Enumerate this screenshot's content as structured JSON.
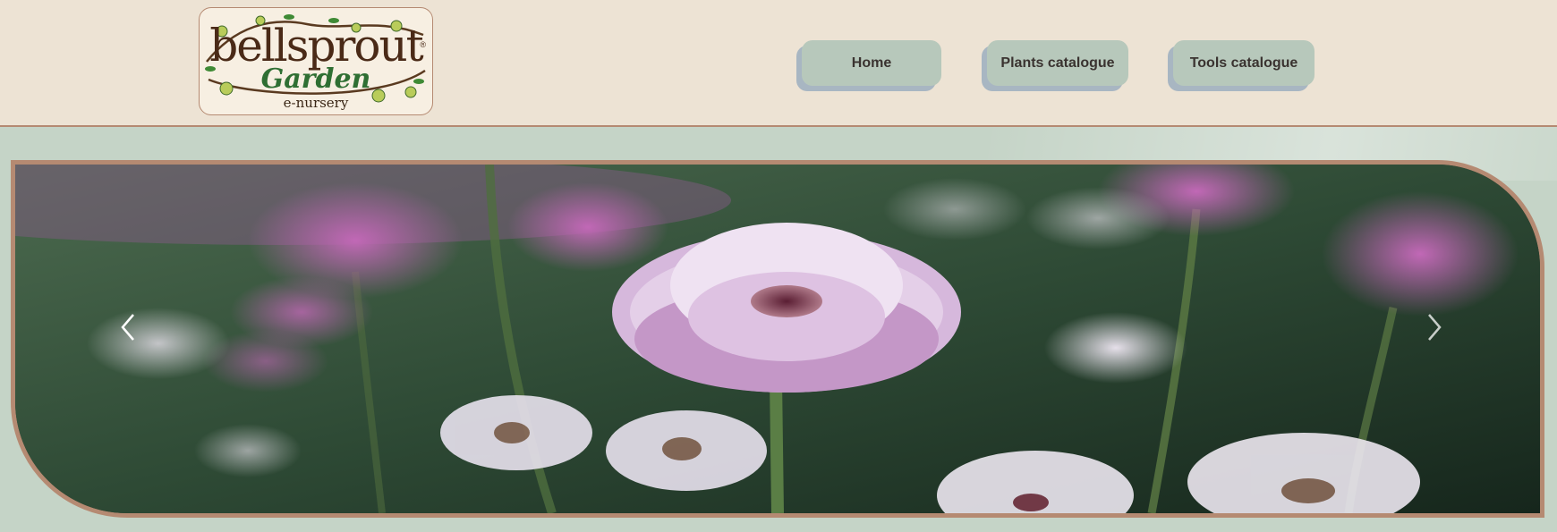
{
  "header": {
    "logo": {
      "brand_word": "bellsprout",
      "garden_word": "Garden",
      "sub_word": "e-nursery",
      "registered": "®"
    },
    "nav": [
      {
        "label": "Home"
      },
      {
        "label": "Plants catalogue"
      },
      {
        "label": "Tools catalogue"
      }
    ]
  },
  "carousel": {
    "image_alt": "flower-garden-photo",
    "prev_icon": "chevron-left-icon",
    "next_icon": "chevron-right-icon"
  },
  "colors": {
    "header_bg": "#ede3d4",
    "page_bg": "#c5d4c7",
    "nav_button_bg": "#b7c8bb",
    "nav_button_shadow": "#a8b6c2",
    "frame_border": "#b58a72",
    "logo_brown": "#4a2a17",
    "logo_green": "#2f6f33"
  }
}
